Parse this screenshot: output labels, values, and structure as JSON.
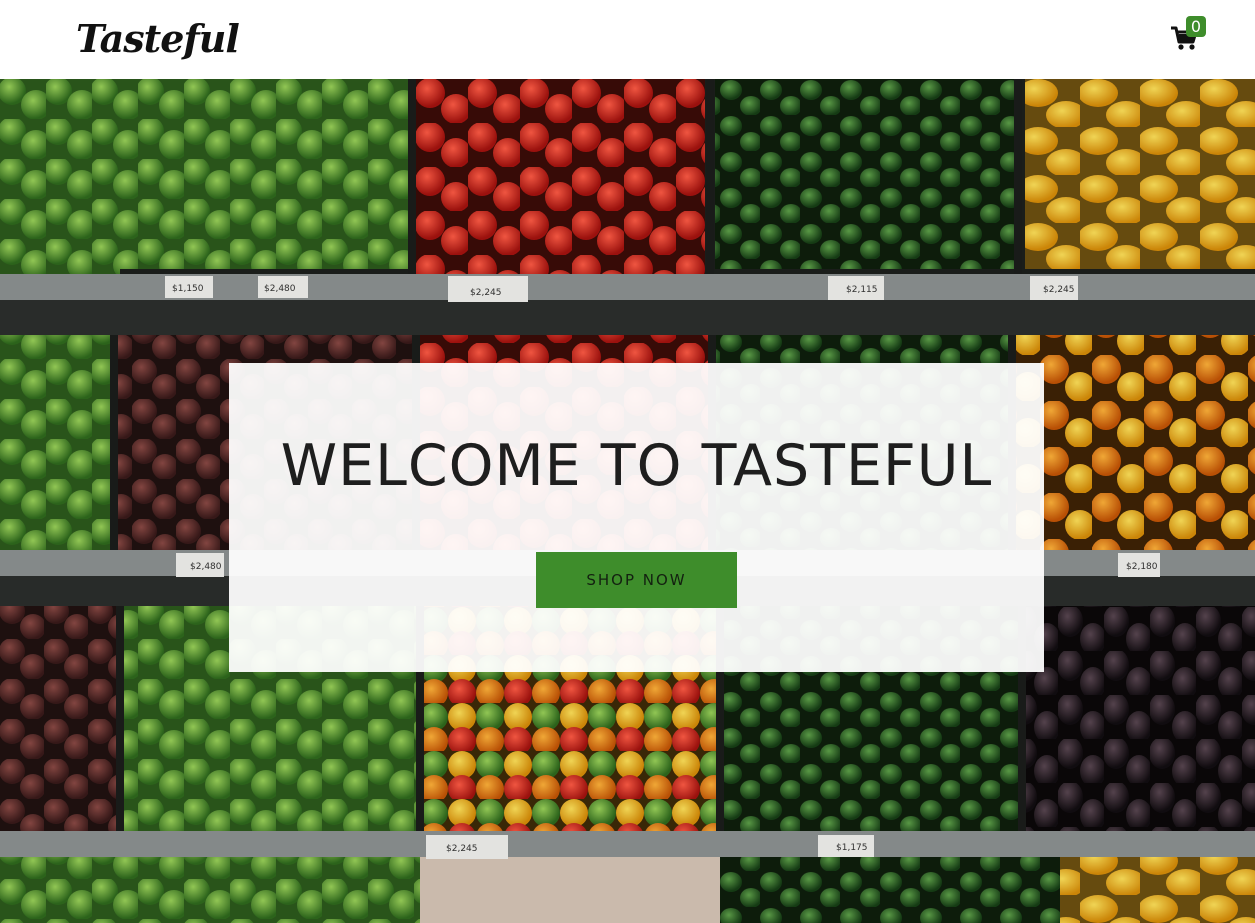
{
  "brand": {
    "name": "Tasteful"
  },
  "cart": {
    "icon": "shopping-cart-icon",
    "count": "0",
    "badge_color": "#3e8d2b"
  },
  "hero": {
    "headline": "WELCOME TO TASTEFUL",
    "cta_label": "SHOP NOW",
    "cta_color": "#3e8d2b",
    "background_image": "produce shelves with lettuce, bell peppers, cucumbers and eggplants",
    "price_tags": [
      "$1,150",
      "$2,480",
      "$2,245",
      "$2,115",
      "$2,245",
      "$2,480",
      "$2,180",
      "$2,245",
      "$1,175"
    ]
  }
}
